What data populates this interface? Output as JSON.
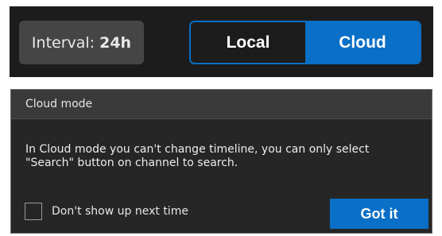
{
  "toolbar": {
    "interval_label": "Interval:",
    "interval_value": "24h",
    "mode_options": [
      "Local",
      "Cloud"
    ],
    "selected_mode": "Cloud"
  },
  "dialog": {
    "title": "Cloud mode",
    "message_line1": "In Cloud mode you can't change timeline, you can only select",
    "message_line2": "\"Search\" button on channel to search.",
    "dont_show_label": "Don't show up next time",
    "dont_show_checked": false,
    "confirm_label": "Got it"
  },
  "colors": {
    "accent": "#0a6fc6",
    "toolbar_bg": "#1c1c1c",
    "interval_bg": "#454545",
    "dialog_bg": "#262626",
    "dialog_header_bg": "#3a3a3a"
  }
}
